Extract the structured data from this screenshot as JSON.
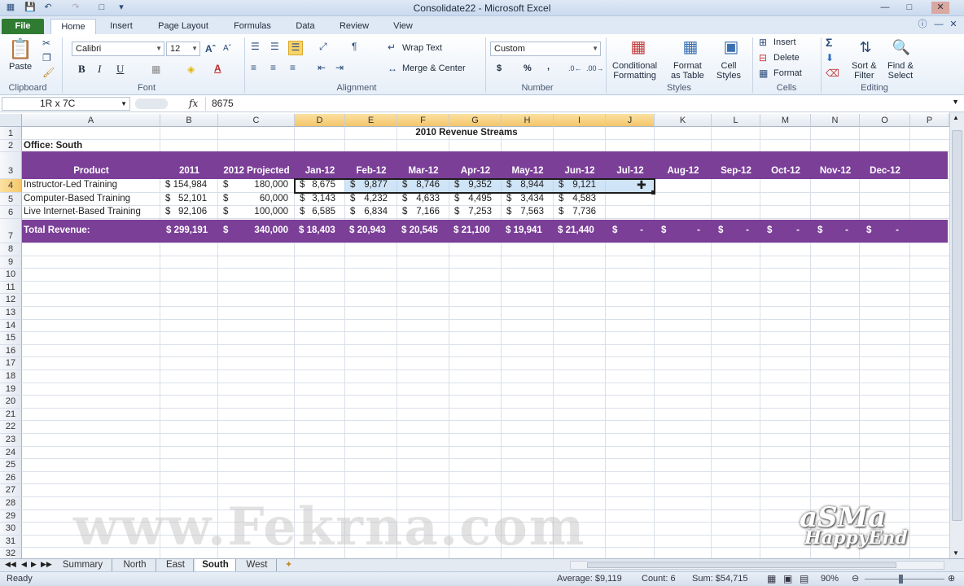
{
  "window": {
    "title": "Consolidate22 - Microsoft Excel"
  },
  "ribbon_tabs": [
    "File",
    "Home",
    "Insert",
    "Page Layout",
    "Formulas",
    "Data",
    "Review",
    "View"
  ],
  "clipboard": {
    "paste": "Paste",
    "group": "Clipboard"
  },
  "font": {
    "name": "Calibri",
    "size": "12",
    "group": "Font",
    "bold": "B",
    "italic": "I",
    "underline": "U"
  },
  "alignment": {
    "wrap": "Wrap Text",
    "merge": "Merge & Center",
    "group": "Alignment"
  },
  "number": {
    "format": "Custom",
    "currency": "$",
    "percent": "%",
    "comma": ",",
    "group": "Number"
  },
  "styles": {
    "conditional": "Conditional\nFormatting",
    "format_table": "Format\nas Table",
    "cell_styles": "Cell\nStyles",
    "group": "Styles"
  },
  "cells_group": {
    "insert": "Insert",
    "delete": "Delete",
    "format": "Format",
    "group": "Cells"
  },
  "editing": {
    "sort": "Sort &\nFilter",
    "find": "Find &\nSelect",
    "group": "Editing"
  },
  "formula_bar": {
    "name_box": "1R x 7C",
    "fx": "fx",
    "content": "8675"
  },
  "columns": [
    "A",
    "B",
    "C",
    "D",
    "E",
    "F",
    "G",
    "H",
    "I",
    "J",
    "K",
    "L",
    "M",
    "N",
    "O",
    "P"
  ],
  "rows": [
    "1",
    "2",
    "3",
    "4",
    "5",
    "6",
    "7",
    "8",
    "9",
    "10",
    "11",
    "12",
    "13",
    "14",
    "15",
    "16",
    "17",
    "18",
    "19",
    "20",
    "21",
    "22",
    "23",
    "24",
    "25",
    "26",
    "27",
    "28",
    "29",
    "30",
    "31",
    "32"
  ],
  "sheet": {
    "title": "2010 Revenue Streams",
    "office": "Office: South",
    "headers": [
      "Product",
      "2011",
      "2012 Projected",
      "Jan-12",
      "Feb-12",
      "Mar-12",
      "Apr-12",
      "May-12",
      "Jun-12",
      "Jul-12",
      "Aug-12",
      "Sep-12",
      "Oct-12",
      "Nov-12",
      "Dec-12"
    ],
    "products": [
      {
        "name": "Instructor-Led Training",
        "y2011": "$ 154,984",
        "p_dollar": "$",
        "p2012": "180,000",
        "months": [
          "8,675",
          "9,877",
          "8,746",
          "9,352",
          "8,944",
          "9,121"
        ]
      },
      {
        "name": "Computer-Based Training",
        "y2011": "$   52,101",
        "p_dollar": "$",
        "p2012": "60,000",
        "months": [
          "3,143",
          "4,232",
          "4,633",
          "4,495",
          "3,434",
          "4,583"
        ]
      },
      {
        "name": "Live Internet-Based Training",
        "y2011": "$   92,106",
        "p_dollar": "$",
        "p2012": "100,000",
        "months": [
          "6,585",
          "6,834",
          "7,166",
          "7,253",
          "7,563",
          "7,736"
        ]
      }
    ],
    "total": {
      "label": "Total Revenue:",
      "y2011": "$ 299,191",
      "p_dollar": "$",
      "p2012": "340,000",
      "months": [
        "$ 18,403",
        "$ 20,943",
        "$ 20,545",
        "$ 21,100",
        "$ 19,941",
        "$ 21,440"
      ],
      "empty": "-"
    }
  },
  "sheet_tabs": [
    "Summary",
    "North",
    "East",
    "South",
    "West"
  ],
  "active_sheet": "South",
  "status": {
    "ready": "Ready",
    "average": "Average: $9,119",
    "count": "Count: 6",
    "sum": "Sum: $54,715",
    "zoom": "90%"
  },
  "watermark": {
    "site": "www.Fekrna.com",
    "line1": "aSMa",
    "line2": "HappyEnd"
  },
  "colors": {
    "header_band": "#7b3f98",
    "file_tab": "#2f7b32",
    "selection": "#aacdf0"
  }
}
